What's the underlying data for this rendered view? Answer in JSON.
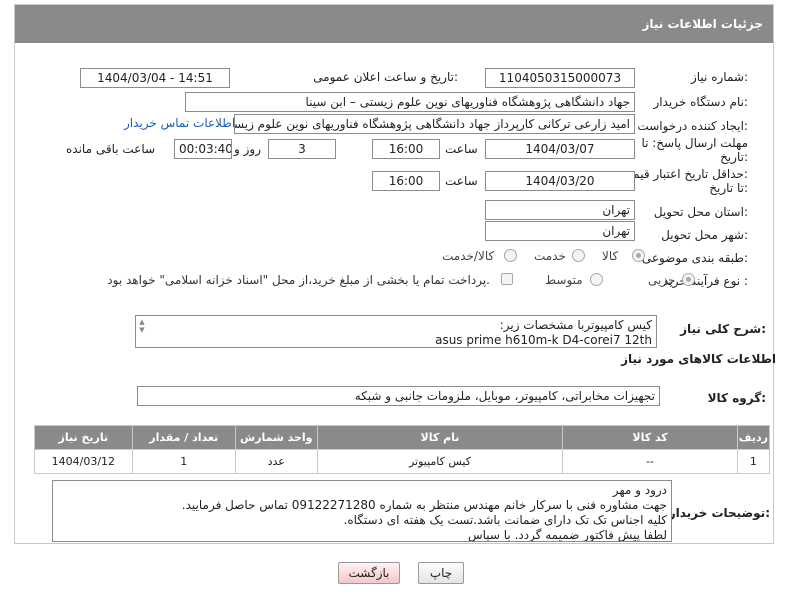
{
  "header": {
    "title": "جزئیات اطلاعات نیاز"
  },
  "fields": {
    "need_number": {
      "label": "شماره نیاز:",
      "value": "1104050315000073"
    },
    "announce_datetime": {
      "label": "تاریخ و ساعت اعلان عمومی:",
      "value": "1404/03/04 - 14:51"
    },
    "buyer_org": {
      "label": "نام دستگاه خریدار:",
      "value": "جهاد دانشگاهی پژوهشگاه فناوریهای نوین علوم زیستی – ابن سینا"
    },
    "requester": {
      "label": "ایجاد کننده درخواست:",
      "value": "امید  زارعی ترکانی  کارپرداز جهاد دانشگاهی پژوهشگاه فناوریهای نوین علوم زیستی",
      "contact_link": "اطلاعات تماس خریدار"
    },
    "reply_deadline": {
      "label_line1": "مهلت ارسال پاسخ: تا",
      "label_line2": "تاریخ:",
      "date": "1404/03/07",
      "time_label": "ساعت",
      "time": "16:00",
      "days": "3",
      "days_label": "روز و",
      "remaining": "00:03:40",
      "remaining_label": "ساعت باقی مانده"
    },
    "price_validity": {
      "label_line1": "حداقل تاریخ اعتبار قیمت:",
      "label_line2": "تا تاریخ:",
      "date": "1404/03/20",
      "time_label": "ساعت",
      "time": "16:00"
    },
    "delivery_province": {
      "label": "استان محل تحویل:",
      "value": "تهران"
    },
    "delivery_city": {
      "label": "شهر محل تحویل:",
      "value": "تهران"
    },
    "category": {
      "label": "طبقه بندی موضوعی:",
      "options": [
        "کالا",
        "خدمت",
        "کالا/خدمت"
      ],
      "selected": "کالا"
    },
    "purchase_process": {
      "label": "نوع فرآیند خرید :",
      "options": [
        "جزیی",
        "متوسط"
      ],
      "selected": "جزیی",
      "payment_note": "پرداخت تمام یا بخشی از مبلغ خرید،از محل \"اسناد خزانه اسلامی\" خواهد بود."
    }
  },
  "general_description": {
    "label": "شرح کلی نیاز:",
    "line1": "کیس کامپیوتربا مشخصات زیر:",
    "line2": "asus prime h610m-k D4-corei7 12th"
  },
  "goods_info": {
    "title": "اطلاعات کالاهای مورد نیاز",
    "group_label": "گروه کالا:",
    "group_value": "تجهیزات مخابراتی، کامپیوتر، موبایل، ملزومات جانبی و شبکه"
  },
  "table": {
    "headers": [
      "ردیف",
      "کد کالا",
      "نام کالا",
      "واحد شمارش",
      "تعداد / مقدار",
      "تاریخ نیاز"
    ],
    "rows": [
      {
        "row": "1",
        "code": "--",
        "name": "کیس کامپیوتر",
        "unit": "عدد",
        "qty": "1",
        "date": "1404/03/12"
      }
    ]
  },
  "buyer_notes": {
    "label": "توضیحات خریدار:",
    "lines": [
      "درود و مهر",
      "جهت مشاوره فنی با سرکار خانم مهندس منتظر به شماره 09122271280 تماس حاصل فرمایید.",
      "کلیه اجناس تک تک دارای ضمانت باشد.تست یک هفته ای دستگاه.",
      "لطفا پیش فاکتور ضمیمه گردد. با سپاس"
    ]
  },
  "buttons": {
    "print": "چاپ",
    "back": "بازگشت"
  },
  "watermark": {
    "text": "AriaTender.neT"
  },
  "colors": {
    "header_bg": "#8a8a8a",
    "link": "#1a5fb4",
    "back_button": "#f3c8c8"
  }
}
